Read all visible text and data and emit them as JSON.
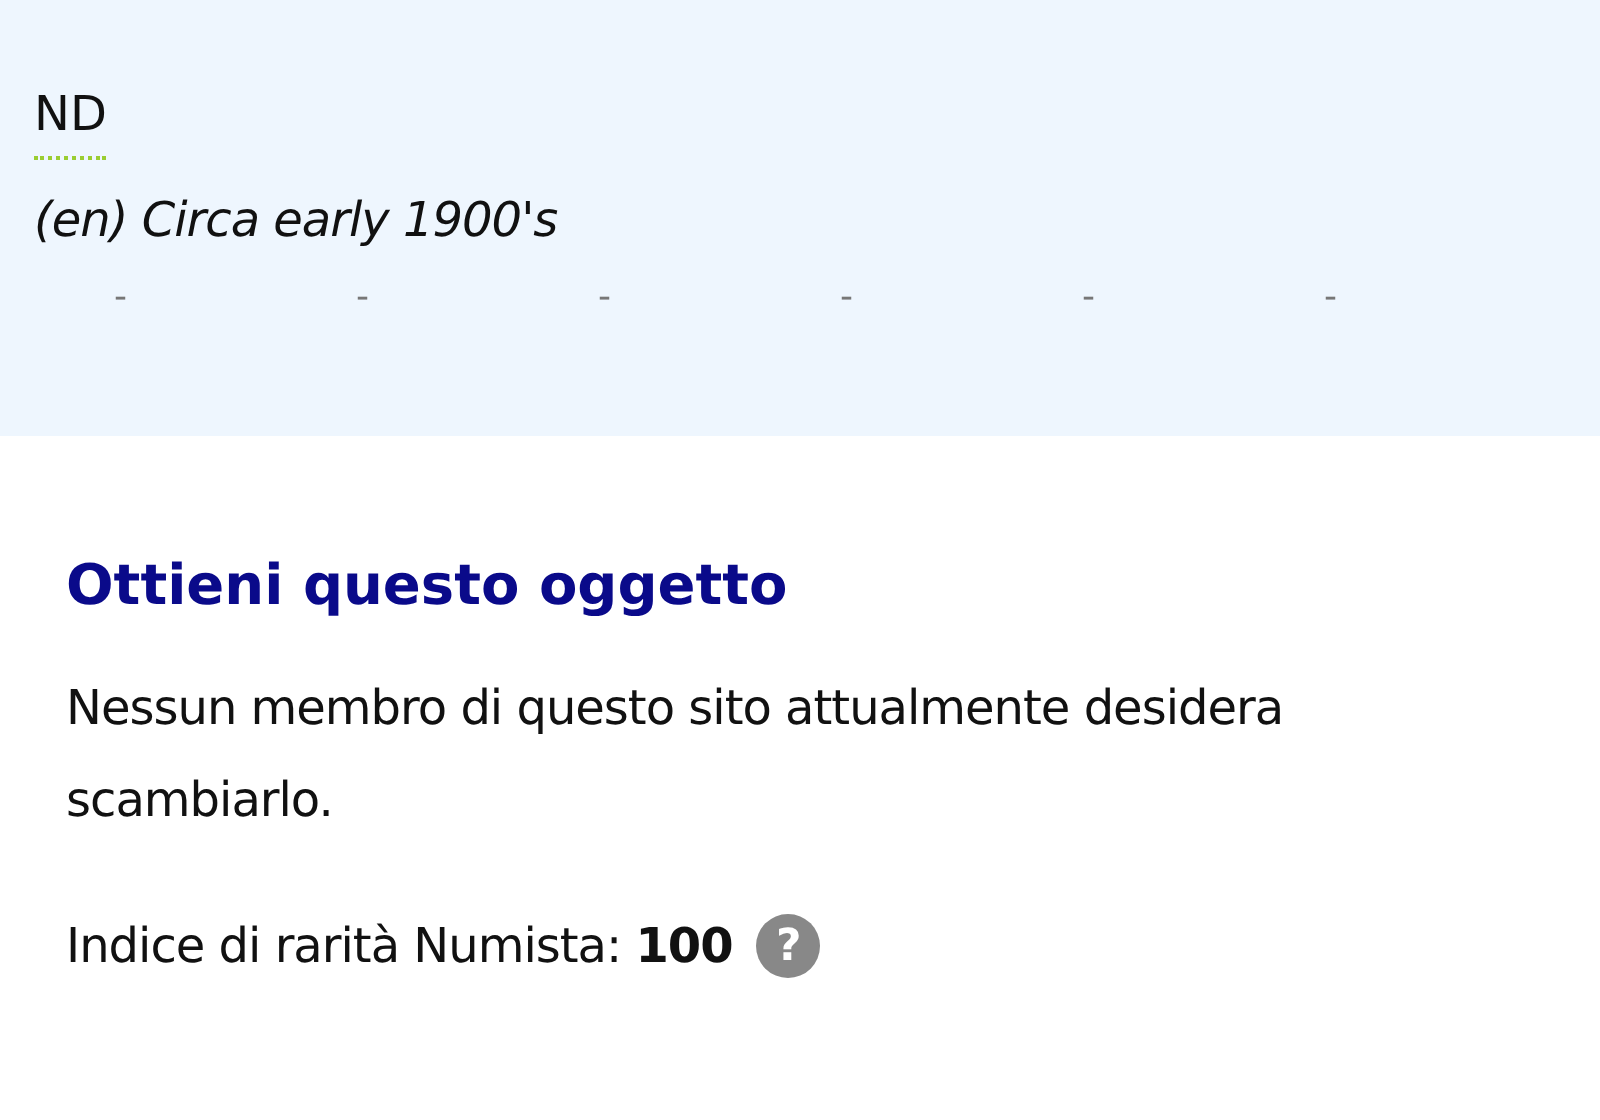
{
  "top": {
    "abbr": "ND",
    "description": "(en) Circa early 1900's",
    "dashes": [
      "-",
      "-",
      "-",
      "-",
      "-",
      "-"
    ]
  },
  "section": {
    "title": "Ottieni questo oggetto",
    "text": "Nessun membro di questo sito attualmente desidera scambiarlo.",
    "rarity": "Indice di rarità Numista: **100**",
    "help": "?"
  }
}
